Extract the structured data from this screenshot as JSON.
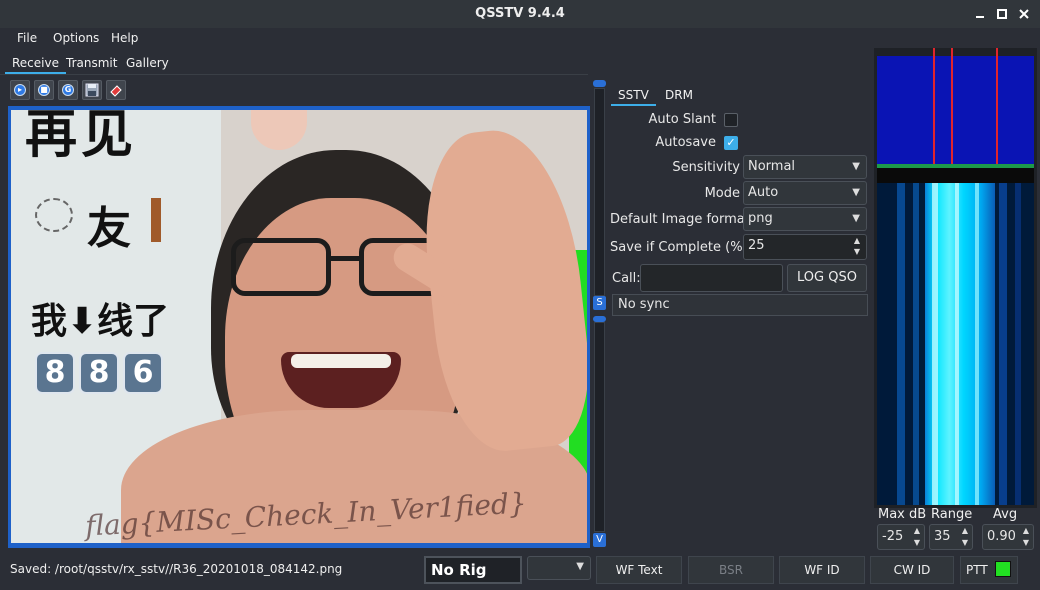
{
  "window": {
    "title": "QSSTV 9.4.4"
  },
  "menu": {
    "items": [
      "File",
      "Options",
      "Help"
    ]
  },
  "main_tabs": [
    "Receive",
    "Transmit",
    "Gallery"
  ],
  "sub_tabs": [
    "SSTV",
    "DRM"
  ],
  "image": {
    "top_text": "再见",
    "friend_text": "友",
    "offline_text": "我⬇线了",
    "digits": [
      "8",
      "8",
      "6"
    ],
    "flag_text": "flag{MISc_Check_In_Ver1fied}"
  },
  "slider": {
    "mid_label": "S",
    "bottom_label": "V"
  },
  "settings": {
    "auto_slant_label": "Auto Slant",
    "auto_slant_checked": false,
    "autosave_label": "Autosave",
    "autosave_checked": true,
    "sensitivity_label": "Sensitivity",
    "sensitivity_value": "Normal",
    "mode_label": "Mode",
    "mode_value": "Auto",
    "image_format_label": "Default Image format",
    "image_format_value": "png",
    "save_complete_label": "Save if Complete (%)",
    "save_complete_value": "25",
    "call_label": "Call:",
    "call_value": "",
    "log_qso_label": "LOG QSO",
    "sync_status": "No sync"
  },
  "waterfall_controls": {
    "max_db_label": "Max dB",
    "max_db_value": "-25",
    "range_label": "Range",
    "range_value": "35",
    "avg_label": "Avg",
    "avg_value": "0.90"
  },
  "status": {
    "saved_text": "Saved: /root/qsstv/rx_sstv//R36_20201018_084142.png",
    "rig_label": "No Rig",
    "wf_text_label": "WF Text",
    "bsr_label": "BSR",
    "wf_id_label": "WF ID",
    "cw_id_label": "CW ID",
    "ptt_label": "PTT"
  },
  "colors": {
    "accent": "#3daee9",
    "ptt_indicator": "#22e022",
    "image_frame": "#1e61c9",
    "spectrum_bg": "#0a14b4",
    "spectrum_markers": "#e0242c",
    "waterfall": "#00e5ff"
  }
}
